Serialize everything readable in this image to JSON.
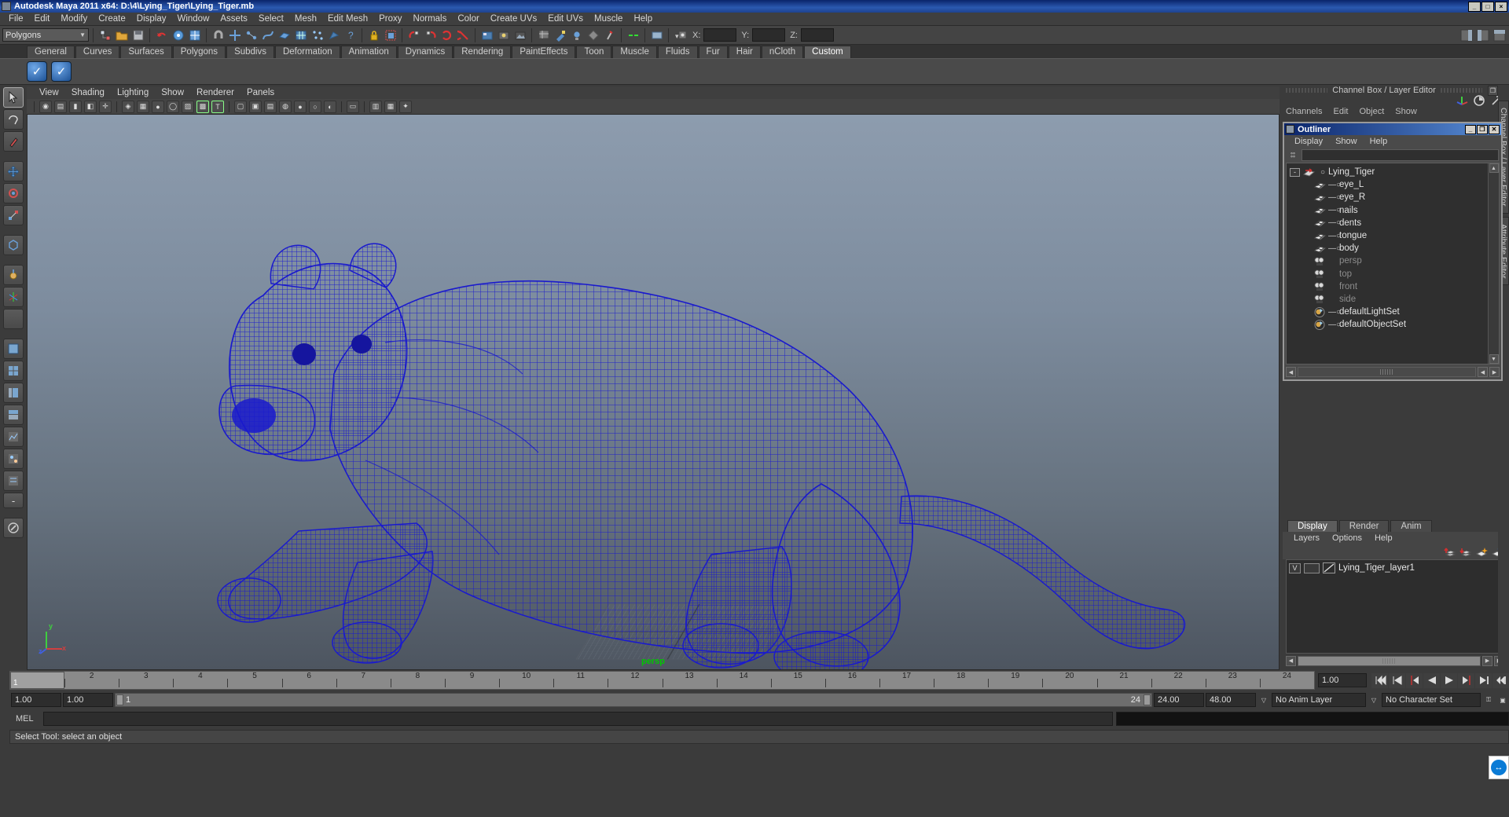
{
  "window": {
    "title": "Autodesk Maya 2011 x64: D:\\4\\Lying_Tiger\\Lying_Tiger.mb",
    "minimize": "_",
    "maximize": "□",
    "close": "×"
  },
  "menubar": [
    "File",
    "Edit",
    "Modify",
    "Create",
    "Display",
    "Window",
    "Assets",
    "Select",
    "Mesh",
    "Edit Mesh",
    "Proxy",
    "Normals",
    "Color",
    "Create UVs",
    "Edit UVs",
    "Muscle",
    "Help"
  ],
  "statusline": {
    "mode_selector": "Polygons",
    "axis_labels": {
      "x": "X:",
      "y": "Y:",
      "z": "Z:"
    },
    "x_value": "",
    "y_value": "",
    "z_value": ""
  },
  "shelf": {
    "tabs": [
      "General",
      "Curves",
      "Surfaces",
      "Polygons",
      "Subdivs",
      "Deformation",
      "Animation",
      "Dynamics",
      "Rendering",
      "PaintEffects",
      "Toon",
      "Muscle",
      "Fluids",
      "Fur",
      "Hair",
      "nCloth",
      "Custom"
    ],
    "active_tab": "Custom",
    "items": [
      "custom-check-1",
      "custom-check-2"
    ]
  },
  "viewport": {
    "menus": [
      "View",
      "Shading",
      "Lighting",
      "Show",
      "Renderer",
      "Panels"
    ],
    "camera_label": "persp",
    "axis": {
      "x": "x",
      "y": "y",
      "z": "z"
    }
  },
  "rightdock": {
    "header": "Channel Box / Layer Editor",
    "channelbox_menus": [
      "Channels",
      "Edit",
      "Object",
      "Show"
    ],
    "vertical_tabs": [
      "Channel Box / Layer Editor",
      "Attribute Editor"
    ]
  },
  "outliner": {
    "title": "Outliner",
    "menus": [
      "Display",
      "Show",
      "Help"
    ],
    "search_value": "",
    "rows": [
      {
        "label": "Lying_Tiger",
        "icon": "transform-icon",
        "depth": 0,
        "dim": false,
        "expander": "-"
      },
      {
        "label": "eye_L",
        "icon": "mesh-icon",
        "depth": 1,
        "dim": false
      },
      {
        "label": "eye_R",
        "icon": "mesh-icon",
        "depth": 1,
        "dim": false
      },
      {
        "label": "nails",
        "icon": "mesh-icon",
        "depth": 1,
        "dim": false
      },
      {
        "label": "dents",
        "icon": "mesh-icon",
        "depth": 1,
        "dim": false
      },
      {
        "label": "tongue",
        "icon": "mesh-icon",
        "depth": 1,
        "dim": false
      },
      {
        "label": "body",
        "icon": "mesh-icon",
        "depth": 1,
        "dim": false
      },
      {
        "label": "persp",
        "icon": "camera-icon",
        "depth": 1,
        "dim": true
      },
      {
        "label": "top",
        "icon": "camera-icon",
        "depth": 1,
        "dim": true
      },
      {
        "label": "front",
        "icon": "camera-icon",
        "depth": 1,
        "dim": true
      },
      {
        "label": "side",
        "icon": "camera-icon",
        "depth": 1,
        "dim": true
      },
      {
        "label": "defaultLightSet",
        "icon": "set-icon",
        "depth": 1,
        "dim": false
      },
      {
        "label": "defaultObjectSet",
        "icon": "set-icon",
        "depth": 1,
        "dim": false
      }
    ]
  },
  "layereditor": {
    "tabs": [
      "Display",
      "Render",
      "Anim"
    ],
    "active_tab": "Display",
    "menus": [
      "Layers",
      "Options",
      "Help"
    ],
    "toolbar_icons": [
      "move-layer-up-icon",
      "move-layer-down-icon",
      "new-layer-icon",
      "new-layer-from-selected-icon"
    ],
    "layers": [
      {
        "visibility": "V",
        "playback": "",
        "name": "Lying_Tiger_layer1"
      }
    ]
  },
  "timeline": {
    "ticks": [
      "1",
      "2",
      "3",
      "4",
      "5",
      "6",
      "7",
      "8",
      "9",
      "10",
      "11",
      "12",
      "13",
      "14",
      "15",
      "16",
      "17",
      "18",
      "19",
      "20",
      "21",
      "22",
      "23",
      "24"
    ],
    "current_frame": "1",
    "current_frame_field": "1.00",
    "playback_buttons": [
      "go-to-start-icon",
      "step-back-key-icon",
      "step-back-frame-icon",
      "play-backwards-icon",
      "play-forwards-icon",
      "step-forward-frame-icon",
      "step-forward-key-icon",
      "go-to-end-icon"
    ]
  },
  "range": {
    "anim_start": "1.00",
    "range_start": "1.00",
    "slider_left": "1",
    "slider_right": "24",
    "range_end": "24.00",
    "anim_end": "48.00",
    "anim_layer": "No Anim Layer",
    "character_set": "No Character Set"
  },
  "mel": {
    "label": "MEL",
    "command": "",
    "output": ""
  },
  "statusbar": {
    "message": "Select Tool: select an object"
  },
  "colors": {
    "wireframe": "#1a1acd",
    "titlebar_start": "#0a246a",
    "viewport_top": "#8d9cae",
    "viewport_bottom": "#4d5560",
    "camera_label": "#00c800",
    "panel_bg": "#3b3b3b"
  }
}
